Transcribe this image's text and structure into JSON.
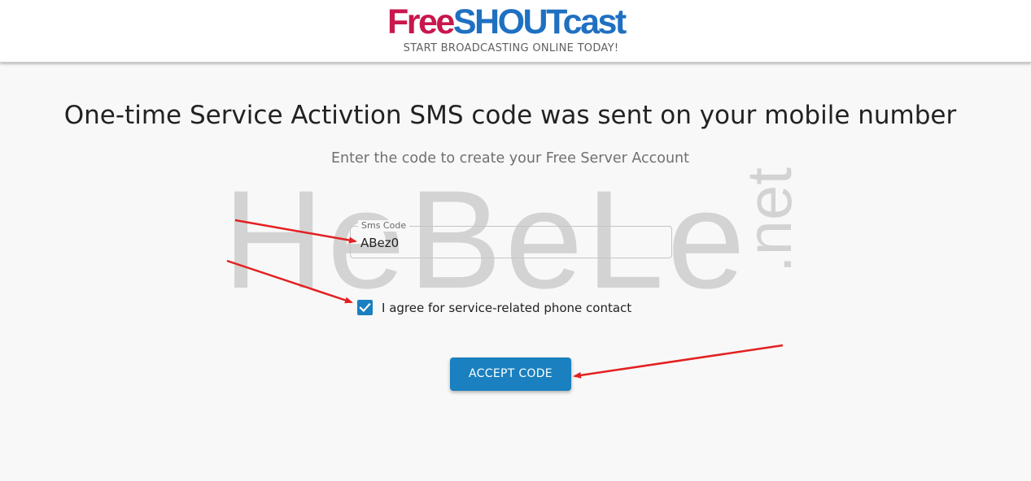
{
  "header": {
    "logo": {
      "part1": "Free",
      "part2": "SHOUT",
      "part3": "cast"
    },
    "tagline": "START BROADCASTING ONLINE TODAY!"
  },
  "main": {
    "title": "One-time Service Activtion SMS code was sent on your mobile number",
    "subtitle": "Enter the code to create your Free Server Account",
    "sms_field": {
      "label": "Sms Code",
      "value": "ABez0"
    },
    "agree_checkbox": {
      "label": "I agree for service-related phone contact",
      "checked": true
    },
    "accept_button": "ACCEPT CODE"
  },
  "watermark": {
    "text": "HeBeLe",
    "suffix": ".net"
  },
  "colors": {
    "brand_red": "#c8174d",
    "brand_blue": "#1f70c1",
    "accent": "#1a80bf",
    "annotation_arrow": "#e32020"
  }
}
